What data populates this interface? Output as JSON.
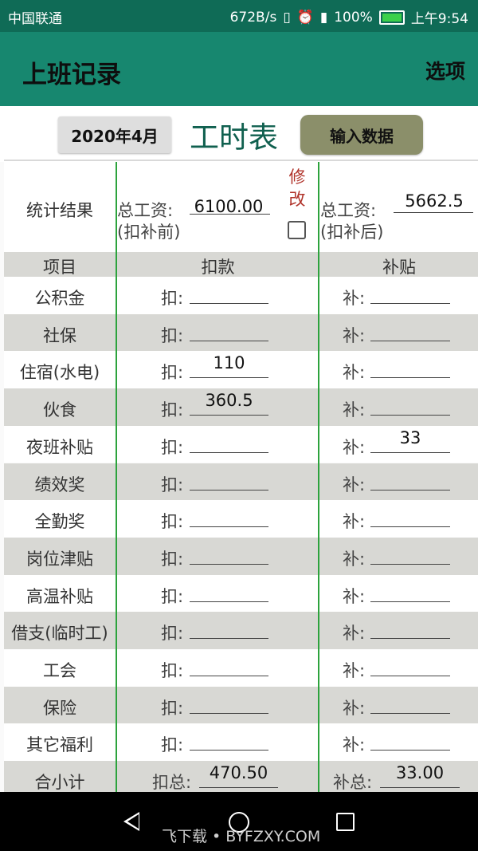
{
  "status_bar": {
    "carrier": "中国联通",
    "speed": "672B/s",
    "battery": "100%",
    "time": "上午9:54"
  },
  "app_bar": {
    "title": "上班记录",
    "options": "选项"
  },
  "toolbar": {
    "month": "2020年4月",
    "sheet_title": "工时表",
    "input_button": "输入数据"
  },
  "summary": {
    "label": "统计结果",
    "gross_label": "总工资:",
    "gross_value": "6100.00",
    "gross_note": "(扣补前)",
    "edit_1": "修",
    "edit_2": "改",
    "net_label": "总工资:",
    "net_value": "5662.5",
    "net_note": "(扣补后)"
  },
  "table": {
    "headers": [
      "项目",
      "扣款",
      "补贴"
    ],
    "deduct_prefix": "扣:",
    "subsidy_prefix": "补:",
    "rows": [
      {
        "name": "公积金",
        "deduct": "",
        "subsidy": ""
      },
      {
        "name": "社保",
        "deduct": "",
        "subsidy": ""
      },
      {
        "name": "住宿(水电)",
        "deduct": "110",
        "subsidy": ""
      },
      {
        "name": "伙食",
        "deduct": "360.5",
        "subsidy": ""
      },
      {
        "name": "夜班补贴",
        "deduct": "",
        "subsidy": "33"
      },
      {
        "name": "绩效奖",
        "deduct": "",
        "subsidy": ""
      },
      {
        "name": "全勤奖",
        "deduct": "",
        "subsidy": ""
      },
      {
        "name": "岗位津贴",
        "deduct": "",
        "subsidy": ""
      },
      {
        "name": "高温补贴",
        "deduct": "",
        "subsidy": ""
      },
      {
        "name": "借支(临时工)",
        "deduct": "",
        "subsidy": ""
      },
      {
        "name": "工会",
        "deduct": "",
        "subsidy": ""
      },
      {
        "name": "保险",
        "deduct": "",
        "subsidy": ""
      },
      {
        "name": "其它福利",
        "deduct": "",
        "subsidy": ""
      }
    ],
    "total": {
      "name": "合小计",
      "deduct_prefix": "扣总:",
      "deduct": "470.50",
      "subsidy_prefix": "补总:",
      "subsidy": "33.00"
    }
  },
  "watermark": "飞下载 • BYFZXY.COM"
}
